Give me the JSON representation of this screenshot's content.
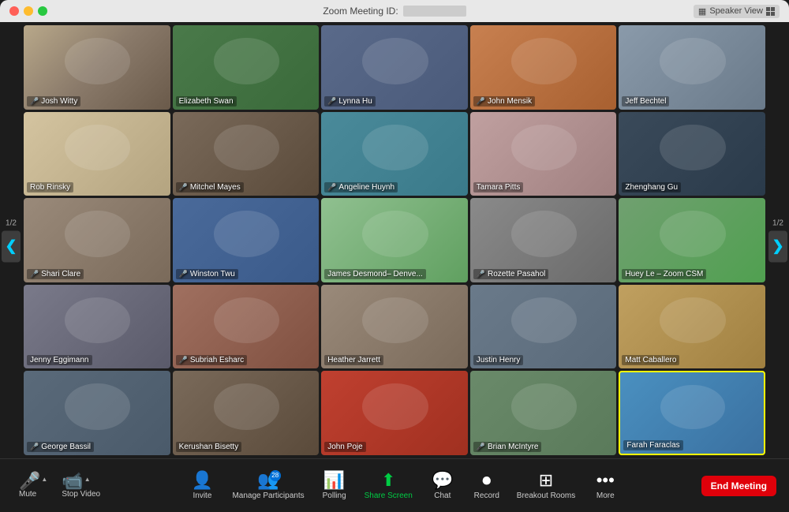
{
  "titleBar": {
    "title": "Zoom Meeting ID:",
    "speakerViewLabel": "Speaker View"
  },
  "participants": [
    {
      "id": "josh",
      "name": "Josh Witty",
      "cellClass": "cell-josh",
      "muted": true
    },
    {
      "id": "elizabeth",
      "name": "Elizabeth Swan",
      "cellClass": "cell-elizabeth",
      "muted": false
    },
    {
      "id": "lynna",
      "name": "Lynna Hu",
      "cellClass": "cell-lynna",
      "muted": true
    },
    {
      "id": "john",
      "name": "John Mensik",
      "cellClass": "cell-john",
      "muted": true
    },
    {
      "id": "jeff",
      "name": "Jeff Bechtel",
      "cellClass": "cell-jeff",
      "muted": false
    },
    {
      "id": "rob",
      "name": "Rob Rinsky",
      "cellClass": "cell-rob",
      "muted": false
    },
    {
      "id": "mitchel",
      "name": "Mitchel Mayes",
      "cellClass": "cell-mitchel",
      "muted": true
    },
    {
      "id": "angeline",
      "name": "Angeline Huynh",
      "cellClass": "cell-angeline",
      "muted": true
    },
    {
      "id": "tamara",
      "name": "Tamara Pitts",
      "cellClass": "cell-tamara",
      "muted": false
    },
    {
      "id": "zhenghang",
      "name": "Zhenghang Gu",
      "cellClass": "cell-zhenghang",
      "muted": false
    },
    {
      "id": "shari",
      "name": "Shari Clare",
      "cellClass": "cell-shari",
      "muted": true
    },
    {
      "id": "winston",
      "name": "Winston Twu",
      "cellClass": "cell-winston",
      "muted": true
    },
    {
      "id": "james",
      "name": "James Desmond– Denve...",
      "cellClass": "cell-james",
      "muted": false
    },
    {
      "id": "rozette",
      "name": "Rozette Pasahol",
      "cellClass": "cell-rozette",
      "muted": true
    },
    {
      "id": "huey",
      "name": "Huey Le – Zoom CSM",
      "cellClass": "cell-huey",
      "muted": false
    },
    {
      "id": "jenny",
      "name": "Jenny Eggimann",
      "cellClass": "cell-jenny",
      "muted": false
    },
    {
      "id": "subriah",
      "name": "Subriah Esharc",
      "cellClass": "cell-subriah",
      "muted": true
    },
    {
      "id": "heather",
      "name": "Heather Jarrett",
      "cellClass": "cell-heather",
      "muted": false
    },
    {
      "id": "justin",
      "name": "Justin Henry",
      "cellClass": "cell-justin",
      "muted": false
    },
    {
      "id": "matt",
      "name": "Matt Caballero",
      "cellClass": "cell-matt",
      "muted": false
    },
    {
      "id": "george",
      "name": "George Bassil",
      "cellClass": "cell-george",
      "muted": true
    },
    {
      "id": "kerushan",
      "name": "Kerushan Bisetty",
      "cellClass": "cell-kerushan",
      "muted": false
    },
    {
      "id": "johnp",
      "name": "John Poje",
      "cellClass": "cell-john-p",
      "muted": false
    },
    {
      "id": "brian",
      "name": "Brian McIntyre",
      "cellClass": "cell-brian",
      "muted": true
    },
    {
      "id": "farah",
      "name": "Farah Faraclas",
      "cellClass": "cell-farah",
      "muted": false
    }
  ],
  "navigation": {
    "leftPage": "1/2",
    "rightPage": "1/2"
  },
  "toolbar": {
    "mute": "Mute",
    "stopVideo": "Stop Video",
    "invite": "Invite",
    "manageParticipants": "Manage Participants",
    "participantCount": "28",
    "polling": "Polling",
    "shareScreen": "Share Screen",
    "chat": "Chat",
    "record": "Record",
    "breakoutRooms": "Breakout Rooms",
    "more": "More",
    "endMeeting": "End Meeting"
  }
}
